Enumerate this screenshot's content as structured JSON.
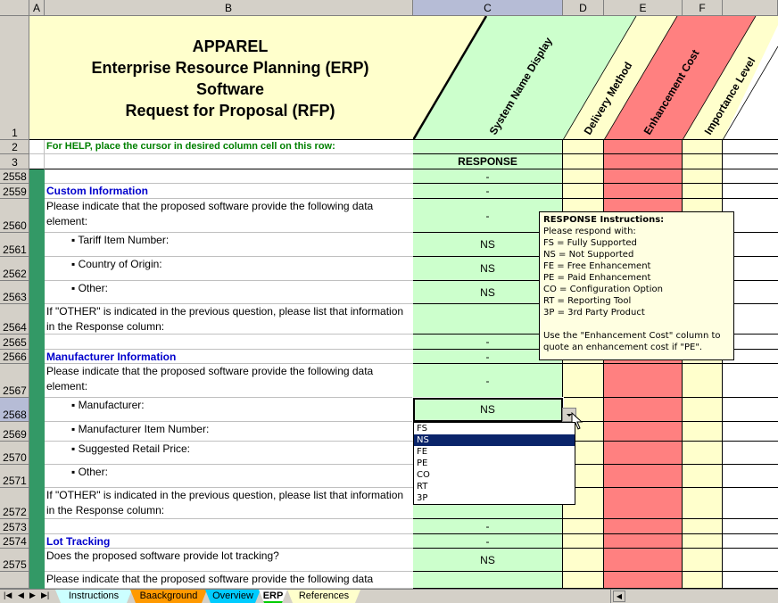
{
  "columns": [
    "A",
    "B",
    "C",
    "D",
    "E",
    "F"
  ],
  "selected_column": "C",
  "title": {
    "lines": [
      "APPAREL",
      "Enterprise Resource Planning (ERP)",
      "Software",
      "Request for Proposal (RFP)"
    ],
    "row": "1"
  },
  "diagonal_headers": [
    "System Name Display",
    "Delivery Method",
    "Enhancement Cost",
    "Importance Level"
  ],
  "help_row": {
    "row": "2",
    "text": "For HELP, place the cursor in desired column cell on this row:"
  },
  "response_row": {
    "row": "3",
    "label": "RESPONSE"
  },
  "rows": [
    {
      "num": "2558",
      "b": "",
      "type": "blank",
      "c": "-"
    },
    {
      "num": "2559",
      "b": "Custom Information",
      "type": "section",
      "c": "-"
    },
    {
      "num": "2560",
      "b": "Please indicate that the proposed software provide the following data element:",
      "type": "text",
      "c": "-"
    },
    {
      "num": "2561",
      "b": "▪ Tariff Item Number:",
      "type": "bullet",
      "c": "NS"
    },
    {
      "num": "2562",
      "b": "▪ Country of Origin:",
      "type": "bullet",
      "c": "NS"
    },
    {
      "num": "2563",
      "b": "▪ Other:",
      "type": "bullet",
      "c": "NS"
    },
    {
      "num": "2564",
      "b": "If \"OTHER\" is indicated in the previous question, please list that information in the Response column:",
      "type": "text",
      "c": ""
    },
    {
      "num": "2565",
      "b": "",
      "type": "blank",
      "c": "-"
    },
    {
      "num": "2566",
      "b": "Manufacturer Information",
      "type": "section",
      "c": "-"
    },
    {
      "num": "2567",
      "b": "Please indicate that the proposed software provide the following data element:",
      "type": "text",
      "c": "-"
    },
    {
      "num": "2568",
      "b": "▪ Manufacturer:",
      "type": "bullet",
      "c": "NS"
    },
    {
      "num": "2569",
      "b": "▪ Manufacturer Item Number:",
      "type": "bullet",
      "c": ""
    },
    {
      "num": "2570",
      "b": "▪ Suggested Retail Price:",
      "type": "bullet",
      "c": ""
    },
    {
      "num": "2571",
      "b": "▪ Other:",
      "type": "bullet",
      "c": ""
    },
    {
      "num": "2572",
      "b": "If \"OTHER\" is indicated in the previous question, please list that information in the Response column:",
      "type": "text",
      "c": ""
    },
    {
      "num": "2573",
      "b": "",
      "type": "blank",
      "c": "-"
    },
    {
      "num": "2574",
      "b": "Lot Tracking",
      "type": "section",
      "c": "-"
    },
    {
      "num": "2575",
      "b": "Does the proposed software provide lot tracking?",
      "type": "text",
      "c": "NS"
    },
    {
      "num": "",
      "b": "Please indicate that the proposed software provide the following data",
      "type": "text",
      "c": ""
    }
  ],
  "selected_row": "2568",
  "tooltip": {
    "title": "RESPONSE Instructions:",
    "lines": [
      "Please respond with:",
      "FS = Fully Supported",
      "NS = Not Supported",
      "FE = Free Enhancement",
      "PE = Paid Enhancement",
      "CO = Configuration Option",
      "RT = Reporting Tool",
      "3P = 3rd Party Product",
      "",
      "Use the \"Enhancement Cost\" column to",
      "quote an enhancement cost if \"PE\"."
    ]
  },
  "dropdown": {
    "options": [
      "FS",
      "NS",
      "FE",
      "PE",
      "CO",
      "RT",
      "3P"
    ],
    "selected": "NS"
  },
  "sheet_tabs": [
    {
      "label": "Instructions",
      "color": "#ccffff",
      "active": false
    },
    {
      "label": "Baackground",
      "color": "#ff9900",
      "active": false
    },
    {
      "label": "Overview",
      "color": "#00ccff",
      "active": false
    },
    {
      "label": "ERP",
      "color": "#ffffff",
      "active": true
    },
    {
      "label": "References",
      "color": "#ffffcc",
      "active": false
    }
  ],
  "colors": {
    "response_green": "#ccffcc",
    "delivery_yellow": "#ffffcc",
    "enhancement_red": "#ff8080",
    "section_blue": "#0000cc",
    "help_green": "#008000",
    "column_a_green": "#339966"
  }
}
